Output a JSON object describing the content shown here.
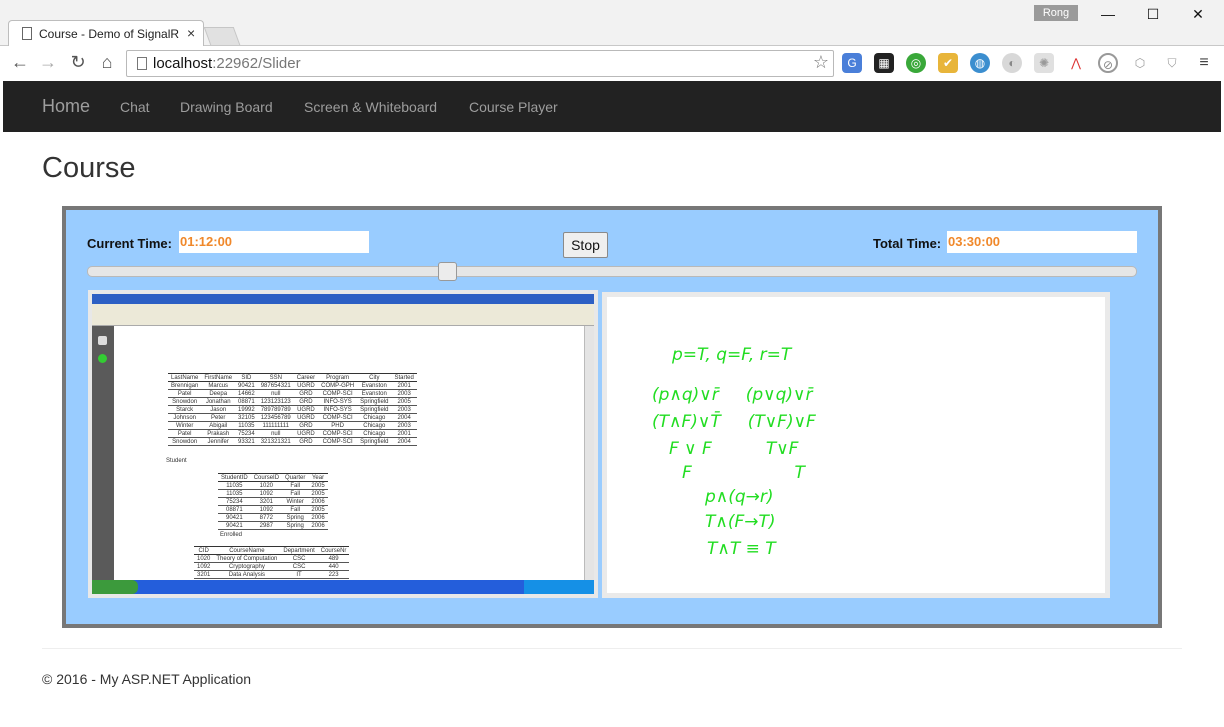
{
  "browser": {
    "tab_title": "Course - Demo of SignalR",
    "tab_close": "×",
    "profile": "Rong",
    "url_host": "localhost",
    "url_rest": ":22962/Slider",
    "window_minimize": "—",
    "window_maximize": "☐",
    "window_close": "✕"
  },
  "navbar": {
    "brand": "Home",
    "links": [
      "Chat",
      "Drawing Board",
      "Screen & Whiteboard",
      "Course Player"
    ]
  },
  "page": {
    "title": "Course"
  },
  "player": {
    "current_time_label": "Current Time:",
    "current_time": "01:12:00",
    "stop_label": "Stop",
    "total_time_label": "Total Time:",
    "total_time": "03:30:00",
    "progress_fraction": 0.343
  },
  "screen_share": {
    "table1": {
      "headers": [
        "LastName",
        "FirstName",
        "SID",
        "SSN",
        "Career",
        "Program",
        "City",
        "Started"
      ],
      "rows": [
        [
          "Brennigan",
          "Marcus",
          "90421",
          "987654321",
          "UGRD",
          "COMP-GPH",
          "Evanston",
          "2001"
        ],
        [
          "Patel",
          "Deepa",
          "14662",
          "null",
          "GRD",
          "COMP-SCI",
          "Evanston",
          "2003"
        ],
        [
          "Snowdon",
          "Jonathan",
          "08871",
          "123123123",
          "GRD",
          "INFO-SYS",
          "Springfield",
          "2005"
        ],
        [
          "Starck",
          "Jason",
          "19992",
          "789789789",
          "UGRD",
          "INFO-SYS",
          "Springfield",
          "2003"
        ],
        [
          "Johnson",
          "Peter",
          "32105",
          "123456789",
          "UGRD",
          "COMP-SCI",
          "Chicago",
          "2004"
        ],
        [
          "Winter",
          "Abigail",
          "11035",
          "111111111",
          "GRD",
          "PHD",
          "Chicago",
          "2003"
        ],
        [
          "Patel",
          "Prakash",
          "75234",
          "null",
          "UGRD",
          "COMP-SCI",
          "Chicago",
          "2001"
        ],
        [
          "Snowdon",
          "Jennifer",
          "93321",
          "321321321",
          "GRD",
          "COMP-SCI",
          "Springfield",
          "2004"
        ]
      ],
      "caption": "Student"
    },
    "table2": {
      "headers": [
        "StudentID",
        "CourseID",
        "Quarter",
        "Year"
      ],
      "rows": [
        [
          "11035",
          "1020",
          "Fall",
          "2005"
        ],
        [
          "11035",
          "1092",
          "Fall",
          "2005"
        ],
        [
          "75234",
          "3201",
          "Winter",
          "2006"
        ],
        [
          "08871",
          "1092",
          "Fall",
          "2005"
        ],
        [
          "90421",
          "8772",
          "Spring",
          "2006"
        ],
        [
          "90421",
          "2987",
          "Spring",
          "2006"
        ]
      ],
      "caption": "Enrolled"
    },
    "table3": {
      "headers": [
        "CID",
        "CourseName",
        "Department",
        "CourseNr"
      ],
      "rows": [
        [
          "1020",
          "Theory of Computation",
          "CSC",
          "489"
        ],
        [
          "1092",
          "Cryptography",
          "CSC",
          "440"
        ],
        [
          "3201",
          "Data Analysis",
          "IT",
          "223"
        ]
      ]
    }
  },
  "whiteboard": {
    "lines": [
      "p=T, q=F, r=T",
      "(p∧q)∨r̄     (p∨q)∨r̄",
      "(T∧F)∨T̄     (T∨F)∨F",
      "F ∨ F          T∨F",
      "F                   T",
      "p∧(q→r)",
      "T∧(F→T)",
      "T∧T ≡ T"
    ],
    "ink_color": "#22dd22"
  },
  "footer": {
    "text": "© 2016 - My ASP.NET Application"
  }
}
